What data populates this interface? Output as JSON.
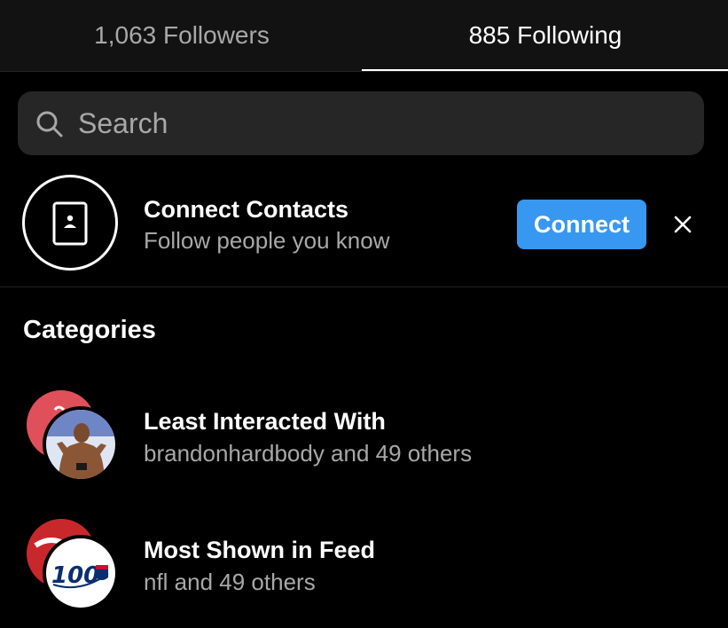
{
  "tabs": {
    "followers": "1,063 Followers",
    "following": "885 Following",
    "active": "following"
  },
  "search": {
    "placeholder": "Search",
    "value": ""
  },
  "connect_contacts": {
    "title": "Connect Contacts",
    "subtitle": "Follow people you know",
    "button_label": "Connect",
    "icon": "contact-book-icon",
    "close_icon": "close-icon"
  },
  "categories": {
    "title": "Categories",
    "items": [
      {
        "title": "Least Interacted With",
        "subtitle": "brandonhardbody and 49 others"
      },
      {
        "title": "Most Shown in Feed",
        "subtitle": "nfl and 49 others",
        "badge_text": "100 NFL"
      }
    ]
  },
  "colors": {
    "background": "#000000",
    "tab_bar": "#121212",
    "search_bg": "#262626",
    "primary_button": "#3897f0",
    "muted_text": "#a8a8a8"
  }
}
